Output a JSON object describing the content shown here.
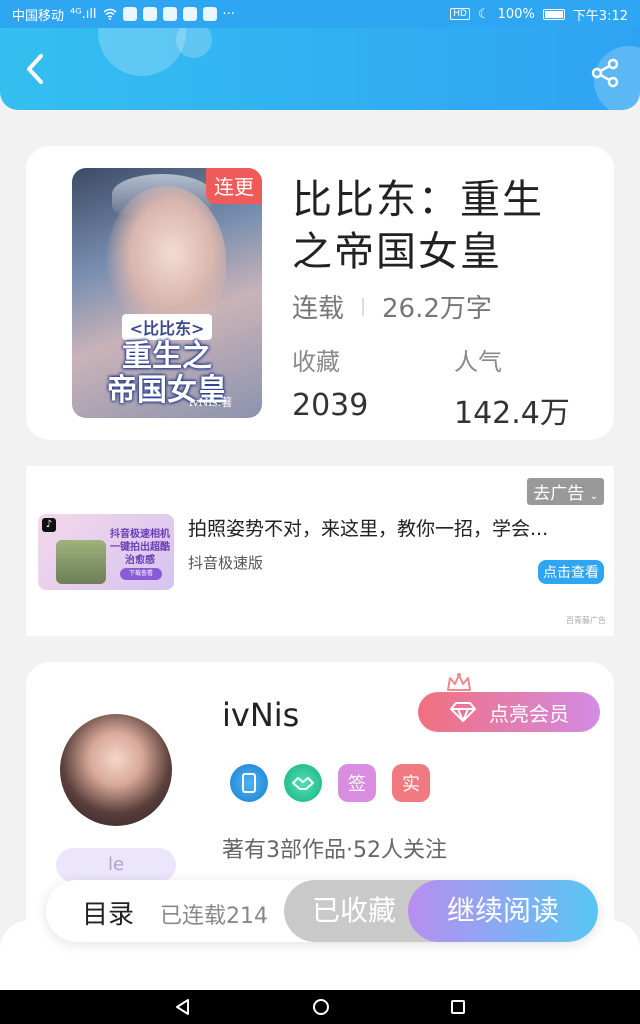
{
  "status_bar": {
    "carrier": "中国移动",
    "signal": "⁴ᴳ.ıll",
    "more": "···",
    "battery": "100%",
    "time": "下午3:12"
  },
  "book": {
    "badge": "连更",
    "cover_small_title": "<比比东>",
    "cover_title_line1": "重生之",
    "cover_title_line2": "帝国女皇",
    "cover_author": "ivNis.著",
    "title": "比比东：重生之帝国女皇",
    "status": "连载",
    "word_count": "26.2万字",
    "favorites_label": "收藏",
    "favorites_value": "2039",
    "popularity_label": "人气",
    "popularity_value": "142.4万"
  },
  "ad": {
    "close_label": "去广告",
    "title": "拍照姿势不对，来这里，教你一招，学会...",
    "source": "抖音极速版",
    "cta": "点击查看",
    "mark": "百青藤广告",
    "thumb_text": "抖音极速相机 一键拍出超酷治愈感",
    "thumb_button": "下载查看"
  },
  "author": {
    "name": "ivNis",
    "vip_label": "点亮会员",
    "badge_sign": "签",
    "badge_real": "实",
    "avatar_tag": "le",
    "stats": "著有3部作品·52人关注"
  },
  "bottom_bar": {
    "toc_label": "目录",
    "toc_status": "已连载214",
    "collected_label": "已收藏",
    "read_label": "继续阅读"
  },
  "colors": {
    "header_start": "#34bff0",
    "header_end": "#2fa3f3",
    "badge_red": "#ef5a5a",
    "vip_start": "#f1707f",
    "vip_end": "#d28be3",
    "read_start": "#b88ef0",
    "read_end": "#58c6f5"
  }
}
